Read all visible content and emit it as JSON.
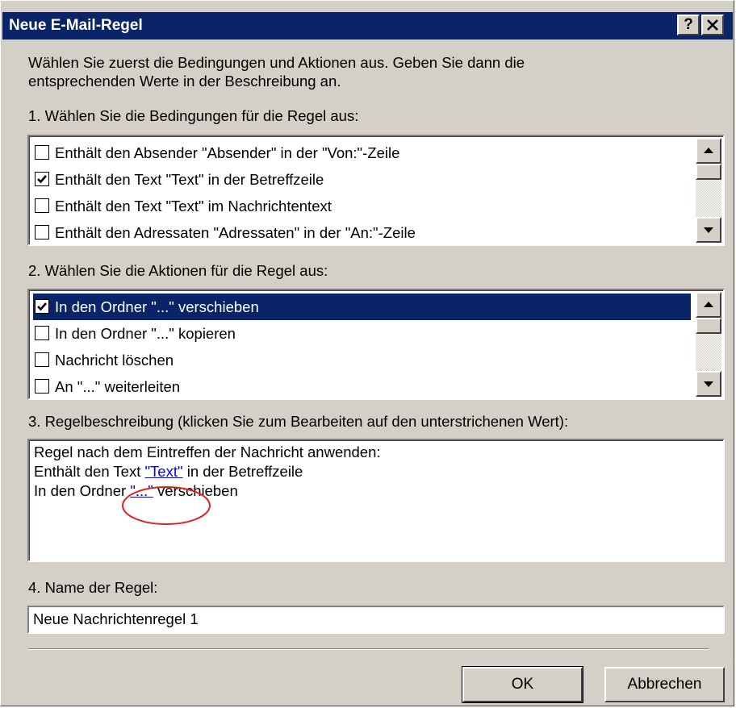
{
  "dialog": {
    "title": "Neue E-Mail-Regel",
    "help_label": "?",
    "close_label": "✕",
    "intro_line1": "Wählen Sie zuerst die Bedingungen und Aktionen aus. Geben Sie dann die",
    "intro_line2": "entsprechenden Werte in der Beschreibung an."
  },
  "conditions": {
    "heading": "1. Wählen Sie die Bedingungen für die Regel aus:",
    "items": [
      {
        "label": "Enthält den Absender \"Absender\" in der \"Von:\"-Zeile",
        "checked": false
      },
      {
        "label": "Enthält den Text \"Text\" in der Betreffzeile",
        "checked": true
      },
      {
        "label": "Enthält den Text \"Text\" im Nachrichtentext",
        "checked": false
      },
      {
        "label": "Enthält den Adressaten \"Adressaten\" in der \"An:\"-Zeile",
        "checked": false
      }
    ]
  },
  "actions": {
    "heading": "2. Wählen Sie die Aktionen für die Regel aus:",
    "items": [
      {
        "label": "In den Ordner \"...\" verschieben",
        "checked": true,
        "selected": true
      },
      {
        "label": "In den Ordner \"...\" kopieren",
        "checked": false
      },
      {
        "label": "Nachricht löschen",
        "checked": false
      },
      {
        "label": "An \"...\" weiterleiten",
        "checked": false
      }
    ]
  },
  "description": {
    "heading": "3. Regelbeschreibung (klicken Sie zum Bearbeiten auf den unterstrichenen Wert):",
    "line1": "Regel nach dem Eintreffen der Nachricht anwenden:",
    "line2_pre": "Enthält den Text ",
    "line2_link": "\"Text\"",
    "line2_post": " in der Betreffzeile",
    "line3_pre": "In den Ordner ",
    "line3_link": "\"...\"",
    "line3_post": " verschieben",
    "annotation_color": "#e02020"
  },
  "name": {
    "heading": "4. Name der Regel:",
    "value": "Neue Nachrichtenregel 1"
  },
  "buttons": {
    "ok": "OK",
    "cancel": "Abbrechen"
  },
  "colors": {
    "face": "#d4d0c8",
    "titlebar": "#0a246a",
    "selection": "#0a246a",
    "link": "#0000ff"
  }
}
